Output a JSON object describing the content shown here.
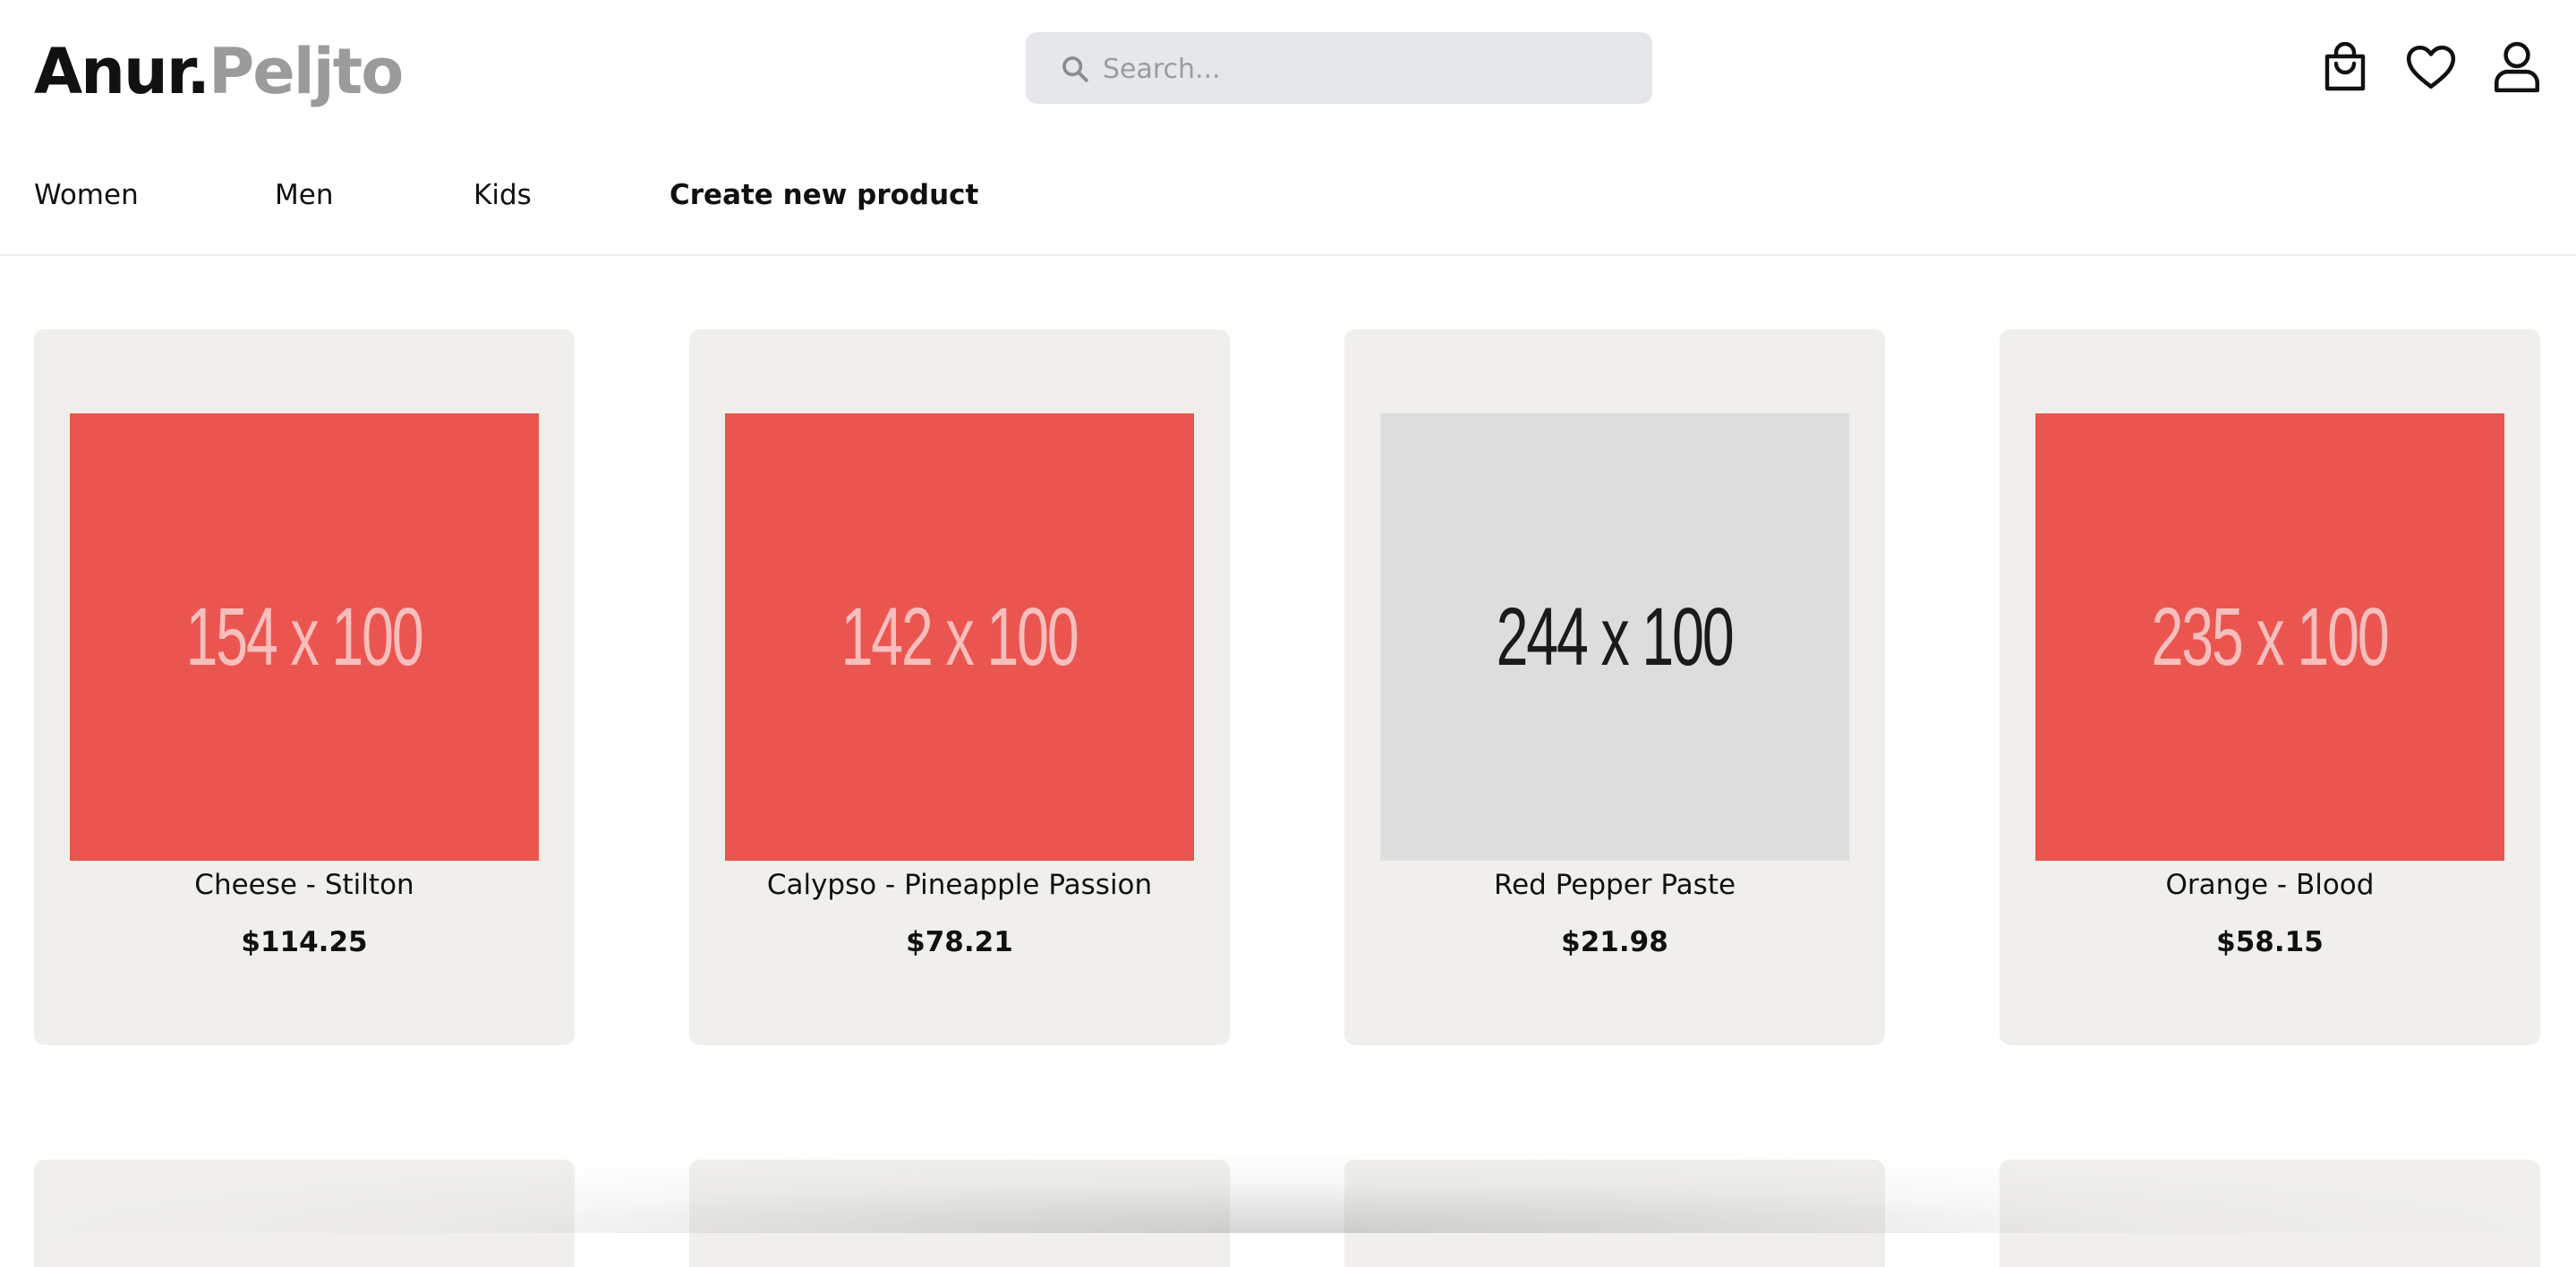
{
  "brand": {
    "first": "Anur.",
    "second": "Peljto"
  },
  "search": {
    "placeholder": "Search..."
  },
  "header_icons": [
    "shopping-bag-icon",
    "heart-icon",
    "user-icon"
  ],
  "nav": {
    "items": [
      "Women",
      "Men",
      "Kids"
    ],
    "create_label": "Create new product"
  },
  "products": [
    {
      "name": "Cheese - Stilton",
      "price": "$114.25",
      "image_text": "154 x 100",
      "image_bg": "#eb5550",
      "image_fg": "#f6bfbd"
    },
    {
      "name": "Calypso - Pineapple Passion",
      "price": "$78.21",
      "image_text": "142 x 100",
      "image_bg": "#eb5550",
      "image_fg": "#f6bfbd"
    },
    {
      "name": "Red Pepper Paste",
      "price": "$21.98",
      "image_text": "244 x 100",
      "image_bg": "#dddddd",
      "image_fg": "#1a1a1a"
    },
    {
      "name": "Orange - Blood",
      "price": "$58.15",
      "image_text": "235 x 100",
      "image_bg": "#eb5550",
      "image_fg": "#f6bfbd"
    }
  ],
  "colors": {
    "card_bg": "#f0efeb",
    "search_bg": "#e6e7ea",
    "brand_gray": "#9b9b9b",
    "placeholder_red": "#eb5550",
    "placeholder_gray": "#dddddd"
  }
}
